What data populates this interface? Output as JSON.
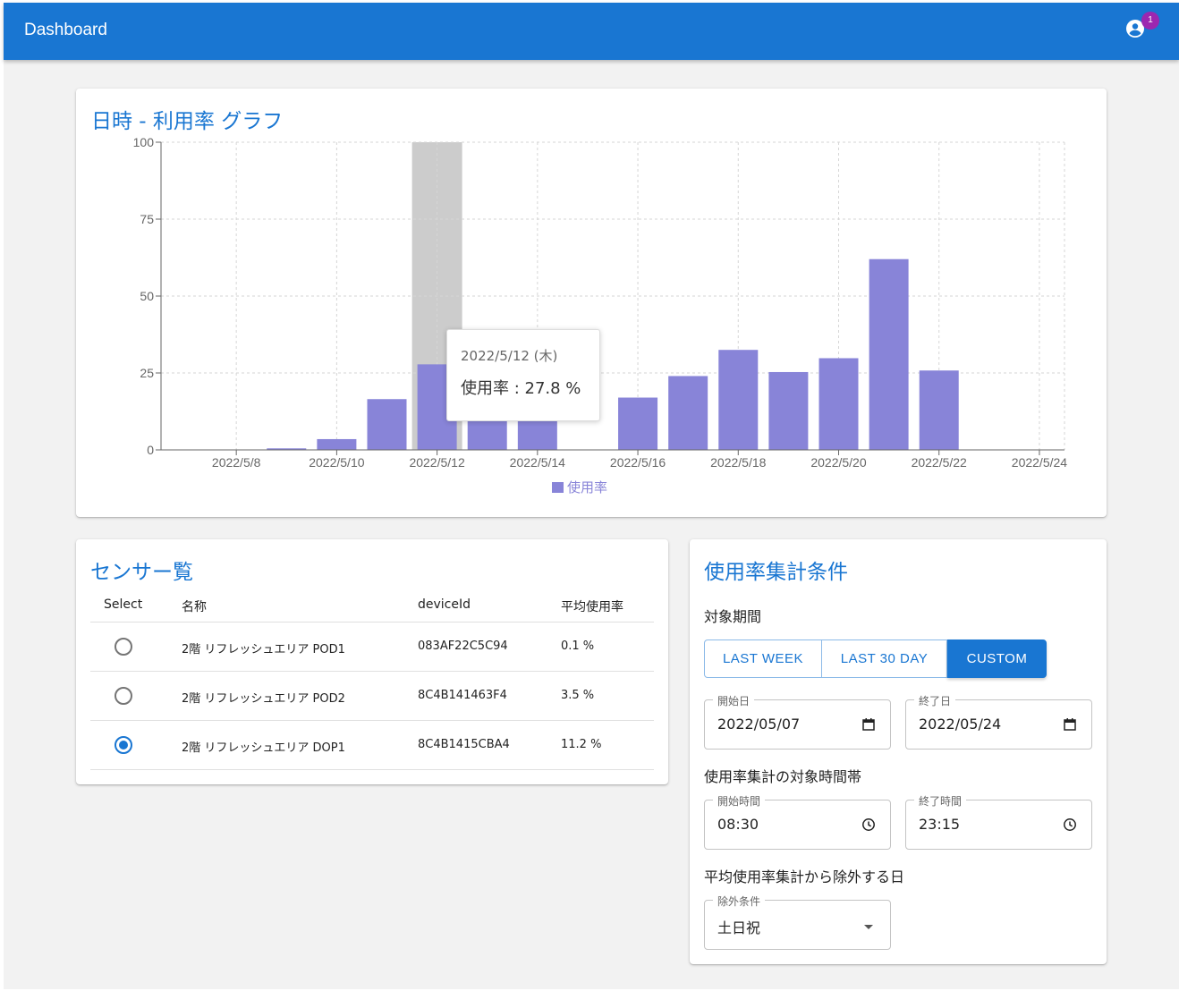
{
  "app": {
    "title": "Dashboard",
    "notification_count": "1",
    "icon": "account-circle-icon"
  },
  "chart_card": {
    "title": "日時 - 利用率 グラフ",
    "tooltip": {
      "date": "2022/5/12 (木)",
      "label": "使用率 : 27.8 %"
    }
  },
  "chart_data": {
    "type": "bar",
    "title": "日時 - 利用率 グラフ",
    "categories": [
      "2022/5/7",
      "2022/5/8",
      "2022/5/9",
      "2022/5/10",
      "2022/5/11",
      "2022/5/12",
      "2022/5/13",
      "2022/5/14",
      "2022/5/15",
      "2022/5/16",
      "2022/5/17",
      "2022/5/18",
      "2022/5/19",
      "2022/5/20",
      "2022/5/21",
      "2022/5/22",
      "2022/5/23",
      "2022/5/24"
    ],
    "tick_labels": [
      "2022/5/8",
      "2022/5/10",
      "2022/5/12",
      "2022/5/14",
      "2022/5/16",
      "2022/5/18",
      "2022/5/20",
      "2022/5/22",
      "2022/5/24"
    ],
    "series": [
      {
        "name": "使用率",
        "color": "#8884d8",
        "values": [
          0,
          0,
          0.5,
          3.5,
          16.5,
          27.8,
          14.5,
          14.5,
          0,
          17,
          24,
          32.5,
          25.3,
          29.8,
          62,
          25.8,
          0,
          0
        ]
      }
    ],
    "ylim": [
      0,
      100
    ],
    "yticks": [
      0,
      25,
      50,
      75,
      100
    ],
    "grid": true,
    "legend": "bottom-center",
    "highlight_category": "2022/5/12"
  },
  "sensor_card": {
    "title": "センサー覧",
    "columns": [
      "Select",
      "名称",
      "deviceId",
      "平均使用率"
    ],
    "rows": [
      {
        "name": "2階 リフレッシュエリア POD1",
        "device_id": "083AF22C5C94",
        "avg": "0.1 %",
        "selected": false
      },
      {
        "name": "2階 リフレッシュエリア POD2",
        "device_id": "8C4B141463F4",
        "avg": "3.5 %",
        "selected": false
      },
      {
        "name": "2階 リフレッシュエリア DOP1",
        "device_id": "8C4B1415CBA4",
        "avg": "11.2 %",
        "selected": true
      }
    ]
  },
  "condition_card": {
    "title": "使用率集計条件",
    "period_label": "対象期間",
    "period_buttons": [
      "LAST WEEK",
      "LAST 30 DAY",
      "CUSTOM"
    ],
    "active_period": "CUSTOM",
    "start_date": {
      "label": "開始日",
      "value": "2022/05/07"
    },
    "end_date": {
      "label": "終了日",
      "value": "2022/05/24"
    },
    "time_label": "使用率集計の対象時間帯",
    "start_time": {
      "label": "開始時間",
      "value": "08:30"
    },
    "end_time": {
      "label": "終了時間",
      "value": "23:15"
    },
    "exclude_label": "平均使用率集計から除外する日",
    "exclude": {
      "label": "除外条件",
      "value": "土日祝"
    }
  }
}
